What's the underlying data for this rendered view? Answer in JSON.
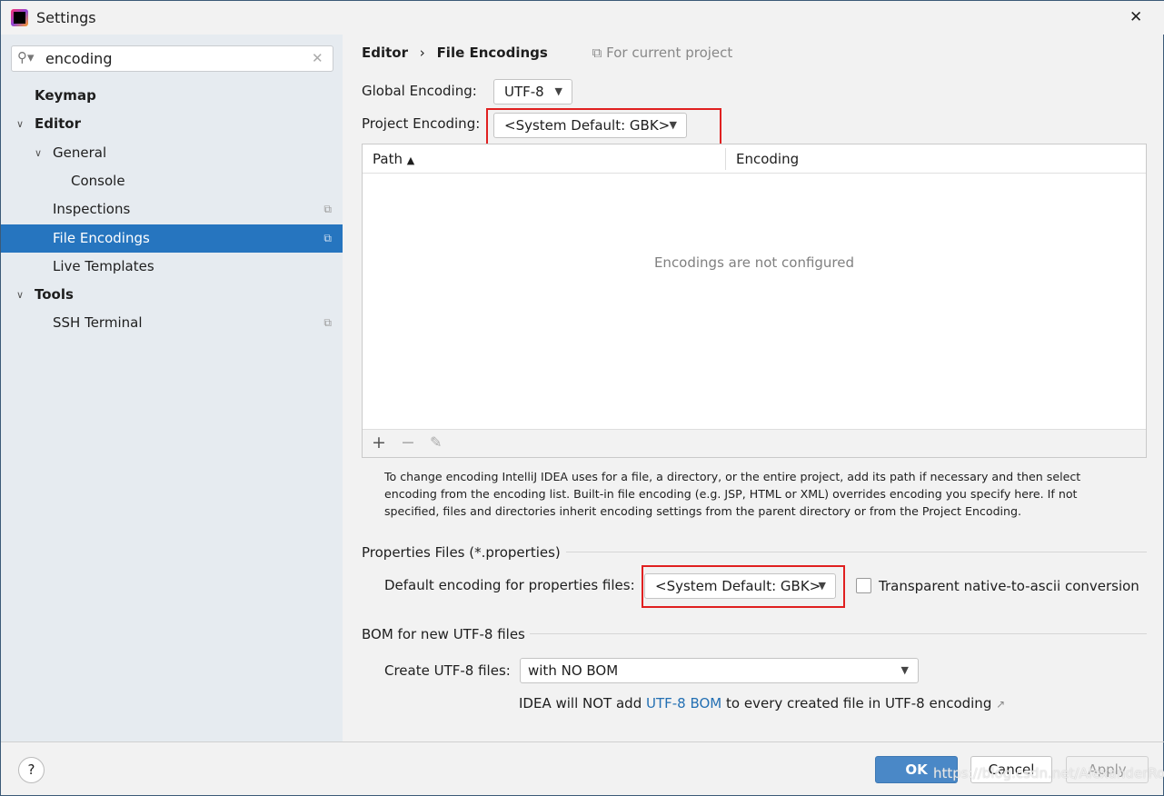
{
  "window": {
    "title": "Settings",
    "close": "✕"
  },
  "search": {
    "value": "encoding"
  },
  "sidebar": {
    "items": [
      {
        "label": "Keymap"
      },
      {
        "label": "Editor"
      },
      {
        "label": "General"
      },
      {
        "label": "Console"
      },
      {
        "label": "Inspections"
      },
      {
        "label": "File Encodings"
      },
      {
        "label": "Live Templates"
      },
      {
        "label": "Tools"
      },
      {
        "label": "SSH Terminal"
      }
    ]
  },
  "breadcrumb": {
    "parent": "Editor",
    "current": "File Encodings",
    "scope": "For current project"
  },
  "global_encoding": {
    "label": "Global Encoding:",
    "value": "UTF-8"
  },
  "project_encoding": {
    "label": "Project Encoding:",
    "value": "<System Default: GBK>"
  },
  "table": {
    "columns": [
      "Path",
      "Encoding"
    ],
    "empty_text": "Encodings are not configured"
  },
  "help_text": "To change encoding IntelliJ IDEA uses for a file, a directory, or the entire project, add its path if necessary and then select encoding from the encoding list. Built-in file encoding (e.g. JSP, HTML or XML) overrides encoding you specify here. If not specified, files and directories inherit encoding settings from the parent directory or from the Project Encoding.",
  "properties": {
    "section": "Properties Files (*.properties)",
    "label": "Default encoding for properties files:",
    "value": "<System Default: GBK>",
    "checkbox_label": "Transparent native-to-ascii conversion",
    "checked": false
  },
  "bom": {
    "section": "BOM for new UTF-8 files",
    "label": "Create UTF-8 files:",
    "value": "with NO BOM",
    "note_pre": "IDEA will NOT add ",
    "note_link": "UTF-8 BOM",
    "note_post": " to every created file in UTF-8 encoding"
  },
  "footer": {
    "help": "?",
    "ok": "OK",
    "cancel": "Cancel",
    "apply": "Apply"
  },
  "watermark": "https://blog.csdn.net/AlexanderRon",
  "colors": {
    "selection": "#2675bf",
    "highlight_box": "#e02020",
    "link": "#2470b3",
    "ok_button": "#4a88c7"
  }
}
